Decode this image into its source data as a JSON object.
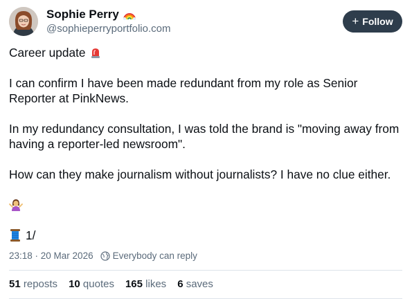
{
  "author": {
    "name": "Sophie Perry",
    "name_emoji_icon": "rainbow-icon",
    "handle": "@sophieperryportfolio.com"
  },
  "follow_label": "Follow",
  "post": {
    "line1": "Career update",
    "line1_icon": "rotating-light-icon",
    "para1": "I can confirm I have been made redundant from my role as Senior Reporter at PinkNews.",
    "para2": "In my redundancy consultation, I was told the brand is \"moving away from having a reporter-led newsroom\".",
    "para3": "How can they make journalism without journalists? I have no clue either.",
    "shrug_icon": "person-shrugging-icon",
    "thread_icon": "thread-spool-icon",
    "thread_label": "1/"
  },
  "meta": {
    "timestamp": "23:18 · 20 Mar 2026",
    "reply_setting": "Everybody can reply"
  },
  "stats": {
    "reposts_count": "51",
    "reposts_label": "reposts",
    "quotes_count": "10",
    "quotes_label": "quotes",
    "likes_count": "165",
    "likes_label": "likes",
    "saves_count": "6",
    "saves_label": "saves"
  },
  "colors": {
    "follow_bg": "#2e3d4c",
    "muted_text": "#5b6b7b",
    "divider": "#dde3ea"
  }
}
